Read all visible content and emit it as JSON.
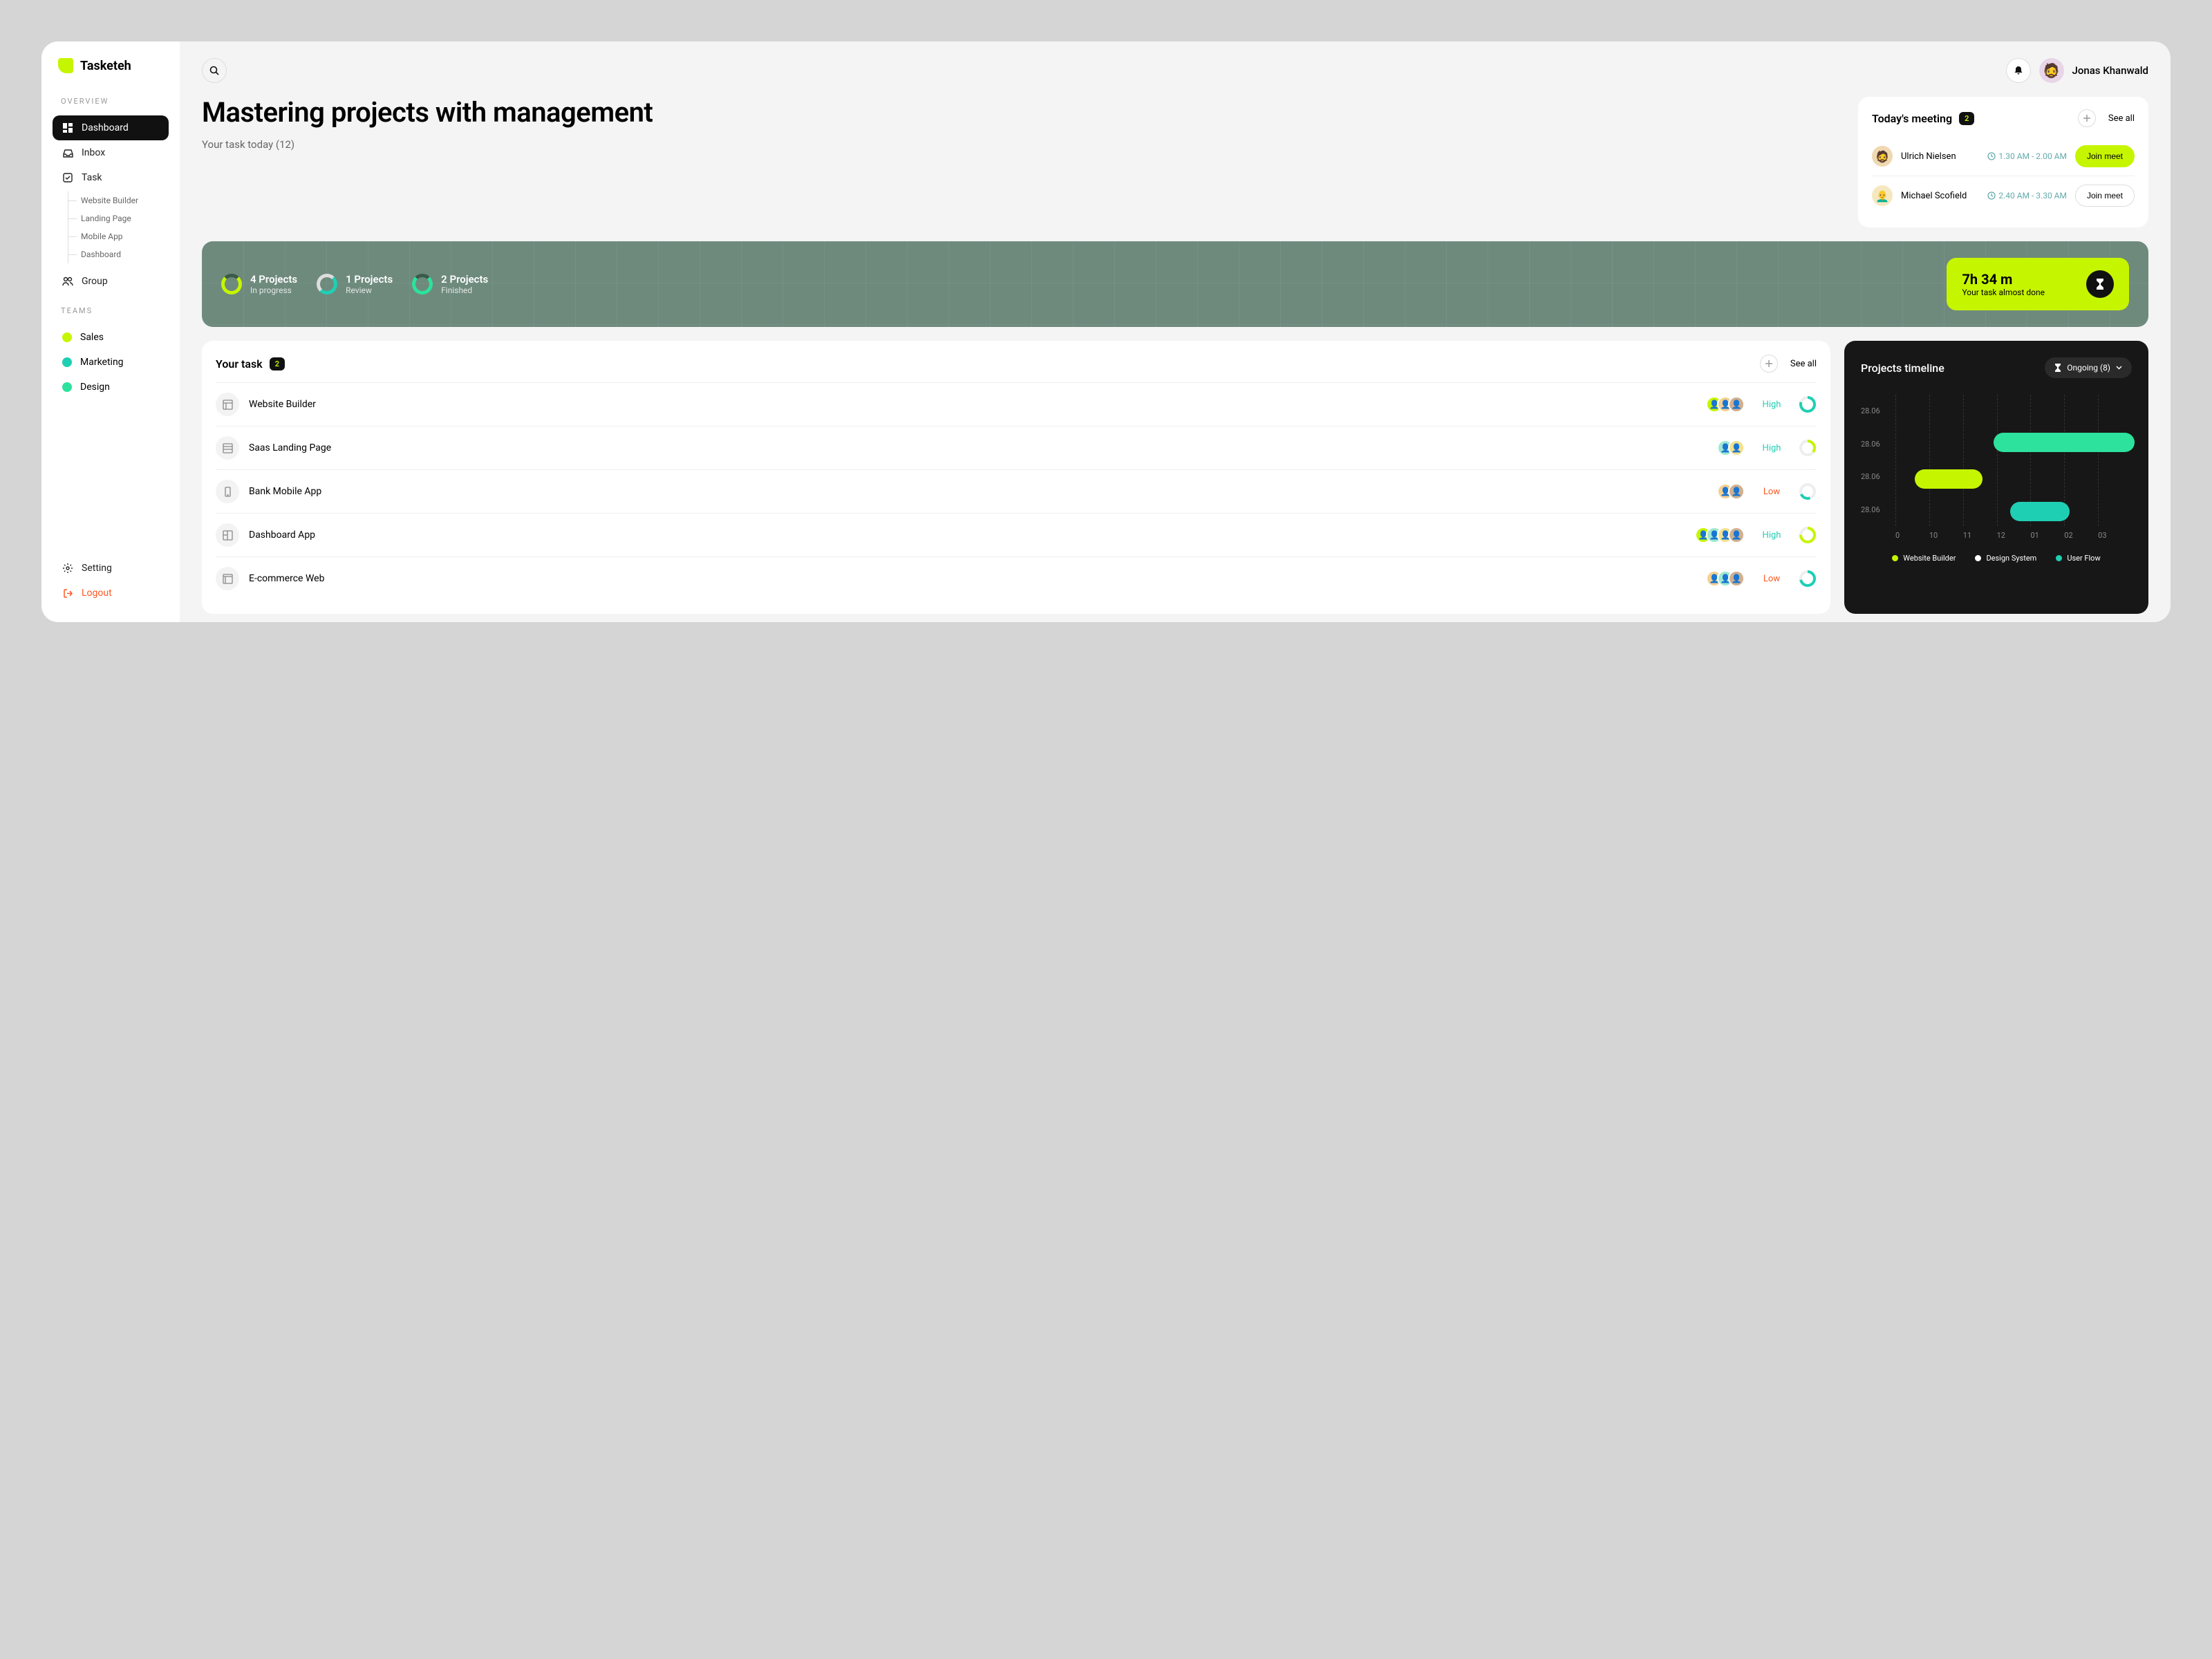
{
  "app_name": "Tasketeh",
  "user": {
    "name": "Jonas Khanwald"
  },
  "sidebar": {
    "section_overview": "OVERVIEW",
    "section_teams": "TEAMS",
    "dashboard": "Dashboard",
    "inbox": "Inbox",
    "task": "Task",
    "task_children": {
      "website_builder": "Website Builder",
      "landing_page": "Landing Page",
      "mobile_app": "Mobile App",
      "dashboard": "Dashboard"
    },
    "group": "Group",
    "teams": {
      "sales": "Sales",
      "marketing": "Marketing",
      "design": "Design"
    },
    "setting": "Setting",
    "logout": "Logout"
  },
  "header": {
    "title": "Mastering projects with management",
    "subtitle": "Your task today (12)"
  },
  "meetings": {
    "title": "Today's meeting",
    "count": "2",
    "see_all": "See all",
    "items": [
      {
        "name": "Ulrich Nielsen",
        "time": "1.30 AM - 2.00 AM",
        "cta": "Join meet",
        "primary": true
      },
      {
        "name": "Michael Scofield",
        "time": "2.40 AM - 3.30 AM",
        "cta": "Join meet",
        "primary": false
      }
    ]
  },
  "stats": {
    "in_progress": {
      "value": "4 Projects",
      "label": "In progress"
    },
    "review": {
      "value": "1 Projects",
      "label": "Review"
    },
    "finished": {
      "value": "2 Projects",
      "label": "Finished"
    },
    "time": {
      "value": "7h 34 m",
      "label": "Your task almost done"
    }
  },
  "tasks": {
    "title": "Your task",
    "count": "2",
    "see_all": "See all",
    "items": [
      {
        "name": "Website Builder",
        "priority": "High",
        "priority_class": "high"
      },
      {
        "name": "Saas Landing Page",
        "priority": "High",
        "priority_class": "high"
      },
      {
        "name": "Bank Mobile App",
        "priority": "Low",
        "priority_class": "low"
      },
      {
        "name": "Dashboard App",
        "priority": "High",
        "priority_class": "high"
      },
      {
        "name": "E-commerce Web",
        "priority": "Low",
        "priority_class": "low"
      }
    ]
  },
  "timeline": {
    "title": "Projects timeline",
    "filter": "Ongoing (8)",
    "y_labels": [
      "28.06",
      "28.06",
      "28.06",
      "28.06"
    ],
    "x_labels": [
      "0",
      "10",
      "11",
      "12",
      "01",
      "02",
      "03"
    ],
    "legend": {
      "a": "Website Builder",
      "b": "Design System",
      "c": "User Flow"
    }
  },
  "chart_data": {
    "type": "bar",
    "title": "Projects timeline",
    "xlabel": "",
    "ylabel": "",
    "x_ticks": [
      "0",
      "10",
      "11",
      "12",
      "01",
      "02",
      "03"
    ],
    "y_ticks": [
      "28.06",
      "28.06",
      "28.06",
      "28.06"
    ],
    "series": [
      {
        "name": "Website Builder",
        "color": "#c6f500",
        "start": "10",
        "end": "11",
        "row": 2
      },
      {
        "name": "Design System",
        "color": "#2de29c",
        "start": "11",
        "end": "03",
        "row": 1
      },
      {
        "name": "User Flow",
        "color": "#1fcfb4",
        "start": "12",
        "end": "01",
        "row": 3
      }
    ]
  },
  "colors": {
    "accent": "#c6f500",
    "teal": "#1fcfb4",
    "green": "#2de29c",
    "orange": "#ff5722"
  }
}
